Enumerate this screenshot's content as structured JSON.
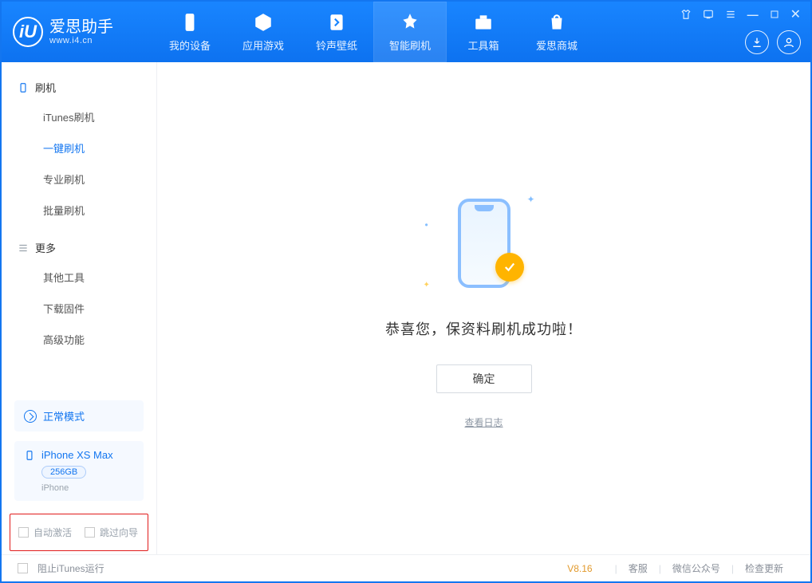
{
  "brand": {
    "title": "爱思助手",
    "subtitle": "www.i4.cn",
    "logo_text": "iU"
  },
  "tabs": [
    {
      "label": "我的设备",
      "icon": "device-icon"
    },
    {
      "label": "应用游戏",
      "icon": "apps-icon"
    },
    {
      "label": "铃声壁纸",
      "icon": "ringtone-icon"
    },
    {
      "label": "智能刷机",
      "icon": "flash-icon"
    },
    {
      "label": "工具箱",
      "icon": "toolbox-icon"
    },
    {
      "label": "爱思商城",
      "icon": "shop-icon"
    }
  ],
  "sidebar": {
    "group_flash": "刷机",
    "group_more": "更多",
    "flash_items": [
      {
        "label": "iTunes刷机"
      },
      {
        "label": "一键刷机"
      },
      {
        "label": "专业刷机"
      },
      {
        "label": "批量刷机"
      }
    ],
    "more_items": [
      {
        "label": "其他工具"
      },
      {
        "label": "下载固件"
      },
      {
        "label": "高级功能"
      }
    ],
    "mode_label": "正常模式",
    "device_name": "iPhone XS Max",
    "device_capacity": "256GB",
    "device_type": "iPhone",
    "auto_activate": "自动激活",
    "skip_guide": "跳过向导"
  },
  "main": {
    "success_text": "恭喜您，保资料刷机成功啦！",
    "ok": "确定",
    "view_log": "查看日志"
  },
  "statusbar": {
    "block_itunes": "阻止iTunes运行",
    "version": "V8.16",
    "link1": "客服",
    "link2": "微信公众号",
    "link3": "检查更新"
  }
}
